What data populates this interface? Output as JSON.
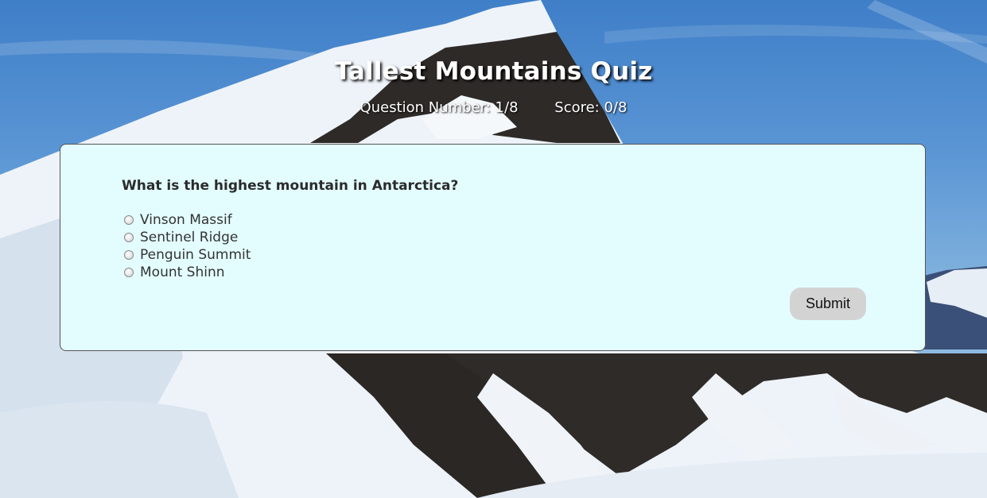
{
  "header": {
    "title": "Tallest Mountains Quiz",
    "question_number_label": "Question Number: 1/8",
    "score_label": "Score: 0/8"
  },
  "quiz": {
    "question": "What is the highest mountain in Antarctica?",
    "options": [
      {
        "label": "Vinson Massif",
        "selected": false
      },
      {
        "label": "Sentinel Ridge",
        "selected": false
      },
      {
        "label": "Penguin Summit",
        "selected": false
      },
      {
        "label": "Mount Shinn",
        "selected": false
      }
    ],
    "submit_label": "Submit"
  },
  "colors": {
    "card_background": "#e3fdff",
    "submit_background": "#d3d3d3"
  }
}
